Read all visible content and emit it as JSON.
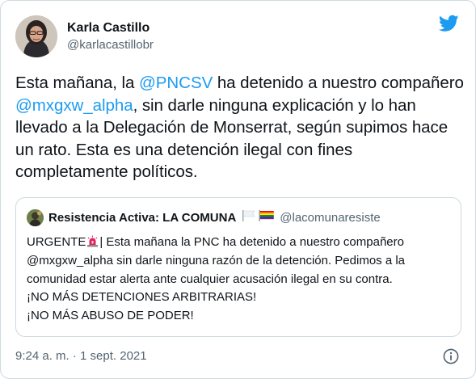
{
  "author": {
    "display_name": "Karla Castillo",
    "handle": "@karlacastillobr"
  },
  "tweet": {
    "segments": [
      {
        "text": "Esta mañana, la ",
        "type": "text"
      },
      {
        "text": "@PNCSV",
        "type": "mention"
      },
      {
        "text": " ha detenido a nuestro compañero ",
        "type": "text"
      },
      {
        "text": "@mxgxw_alpha",
        "type": "mention"
      },
      {
        "text": ", sin darle ninguna explicación y lo han llevado a la Delegación de Monserrat, según supimos hace un rato. Esta es una detención ilegal con fines completamente políticos.",
        "type": "text"
      }
    ]
  },
  "quoted": {
    "display_name": "Resistencia Activa: LA COMUNA",
    "handle": "@lacomunaresiste",
    "lines": {
      "l1_a": "URGENTE",
      "l1_b": "| Esta mañana la PNC ha detenido a nuestro compañero",
      "l2": "@mxgxw_alpha sin darle ninguna razón de la detención. Pedimos a la",
      "l3": "comunidad estar alerta ante cualquier acusación ilegal en su contra.",
      "l4": "¡NO MÁS DETENCIONES ARBITRARIAS!",
      "l5": "¡NO MÁS ABUSO DE PODER!"
    }
  },
  "timestamp": "9:24 a. m. · 1 sept. 2021",
  "icons": {
    "brand": "twitter-bird-icon",
    "siren": "police-light-icon",
    "flags": [
      "white-flag-icon",
      "rainbow-flag-icon"
    ],
    "info": "info-icon"
  },
  "colors": {
    "accent": "#1d9bf0",
    "text": "#0f1419",
    "secondary": "#536471",
    "border": "#cfd9de"
  }
}
